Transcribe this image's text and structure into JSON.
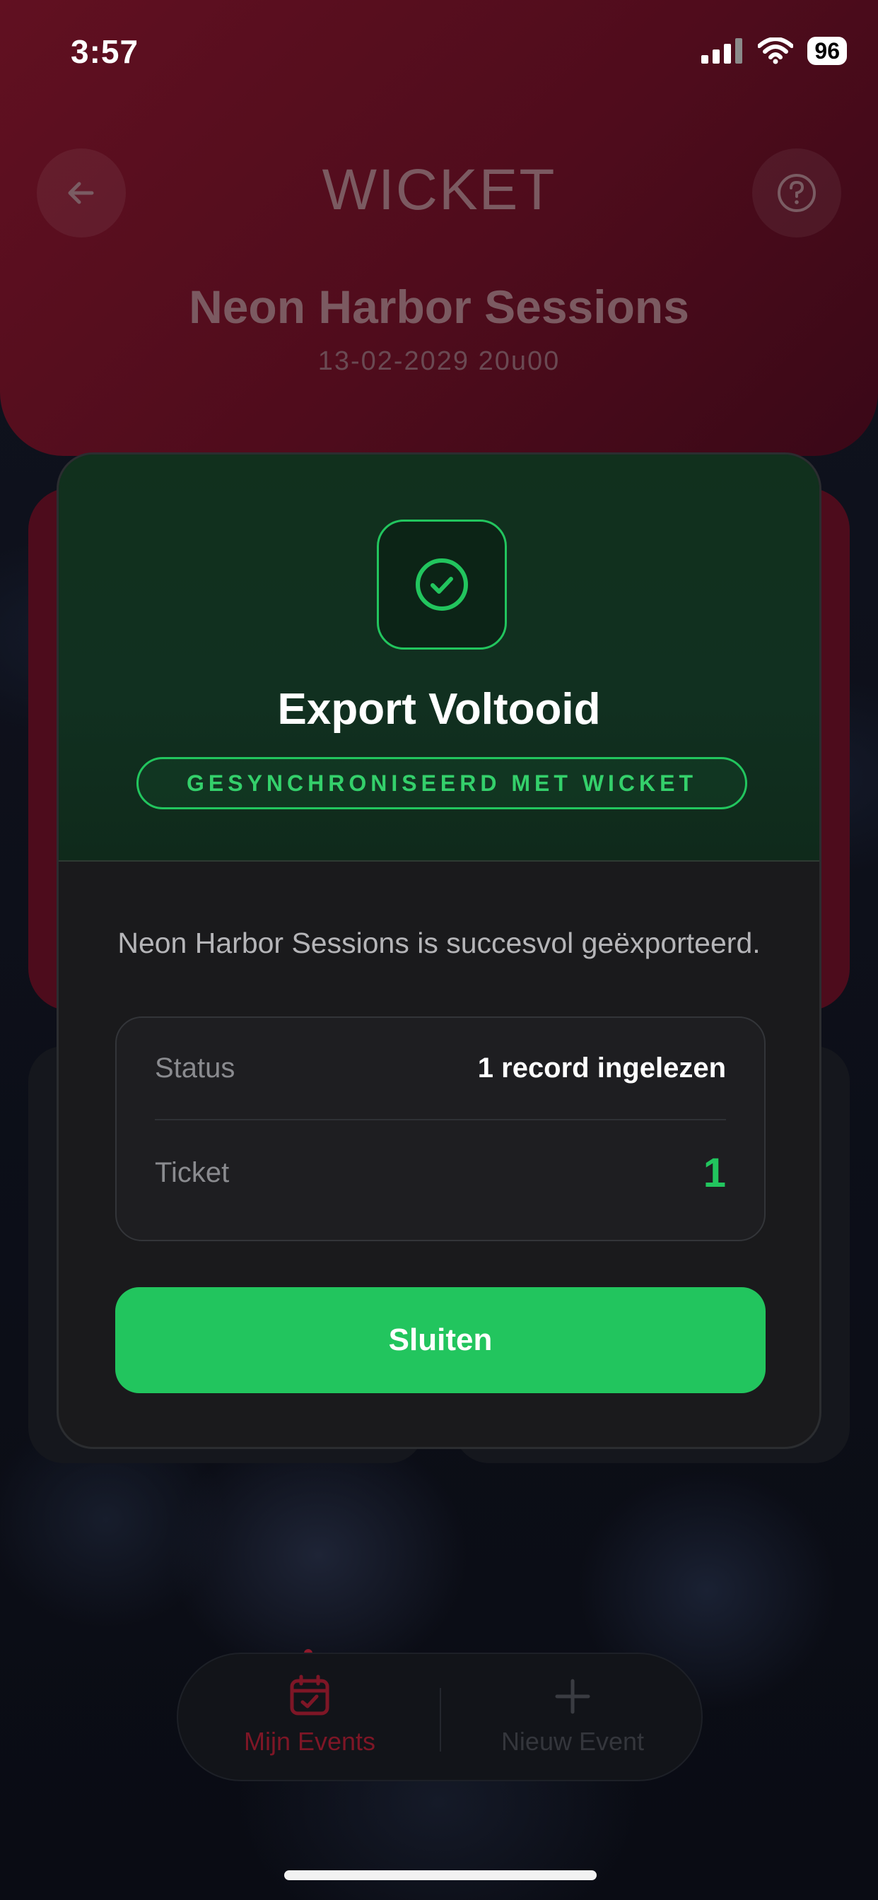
{
  "status_bar": {
    "time": "3:57",
    "battery": "96"
  },
  "header": {
    "logo": "WICKET",
    "event_title": "Neon Harbor Sessions",
    "event_date": "13-02-2029 20u00"
  },
  "modal": {
    "title": "Export Voltooid",
    "badge": "GESYNCHRONISEERD MET WICKET",
    "message": "Neon Harbor Sessions is succesvol geëxporteerd.",
    "rows": [
      {
        "label": "Status",
        "value": "1 record ingelezen"
      },
      {
        "label": "Ticket",
        "value": "1"
      }
    ],
    "close_label": "Sluiten"
  },
  "tab_bar": {
    "items": [
      {
        "label": "Mijn Events",
        "icon": "calendar-check-icon"
      },
      {
        "label": "Nieuw Event",
        "icon": "plus-icon"
      }
    ]
  },
  "colors": {
    "accent_green": "#22c55e",
    "header_red": "#611021",
    "modal_bg": "#1a1a1c"
  }
}
